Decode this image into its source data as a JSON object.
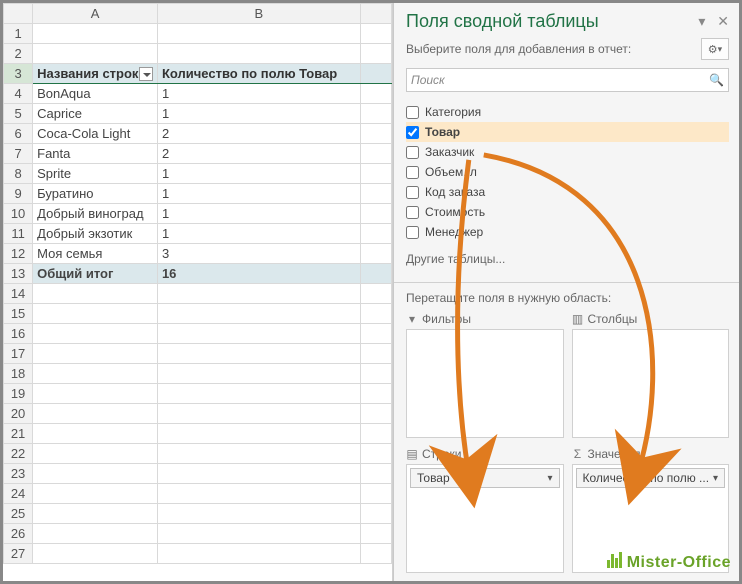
{
  "sheet": {
    "columns": [
      "A",
      "B"
    ],
    "header_row": 3,
    "headers": {
      "A": "Названия строк",
      "B": "Количество по полю Товар"
    },
    "rows": [
      {
        "n": 4,
        "a": "BonAqua",
        "b": 1
      },
      {
        "n": 5,
        "a": "Caprice",
        "b": 1
      },
      {
        "n": 6,
        "a": "Coca-Cola Light",
        "b": 2
      },
      {
        "n": 7,
        "a": "Fanta",
        "b": 2
      },
      {
        "n": 8,
        "a": "Sprite",
        "b": 1
      },
      {
        "n": 9,
        "a": "Буратино",
        "b": 1
      },
      {
        "n": 10,
        "a": "Добрый виноград",
        "b": 1
      },
      {
        "n": 11,
        "a": "Добрый экзотик",
        "b": 1
      },
      {
        "n": 12,
        "a": "Моя семья",
        "b": 3
      }
    ],
    "total": {
      "n": 13,
      "label": "Общий итог",
      "value": 16
    },
    "empty_rows": [
      1,
      2,
      14,
      15,
      16,
      17,
      18,
      19,
      20,
      21,
      22,
      23,
      24,
      25,
      26,
      27
    ]
  },
  "pane": {
    "title": "Поля сводной таблицы",
    "subtitle": "Выберите поля для добавления в отчет:",
    "search_placeholder": "Поиск",
    "fields": [
      {
        "label": "Категория",
        "checked": false
      },
      {
        "label": "Товар",
        "checked": true
      },
      {
        "label": "Заказчик",
        "checked": false
      },
      {
        "label": "Объем, л",
        "checked": false
      },
      {
        "label": "Код заказа",
        "checked": false
      },
      {
        "label": "Стоимость",
        "checked": false
      },
      {
        "label": "Менеджер",
        "checked": false
      }
    ],
    "other_tables": "Другие таблицы...",
    "drag_hint": "Перетащите поля в нужную область:",
    "zones": {
      "filters": {
        "label": "Фильтры"
      },
      "columns": {
        "label": "Столбцы"
      },
      "rows": {
        "label": "Строки",
        "item": "Товар"
      },
      "values": {
        "label": "Значения",
        "item": "Количество по полю ..."
      }
    }
  },
  "watermark": "Mister-Office"
}
